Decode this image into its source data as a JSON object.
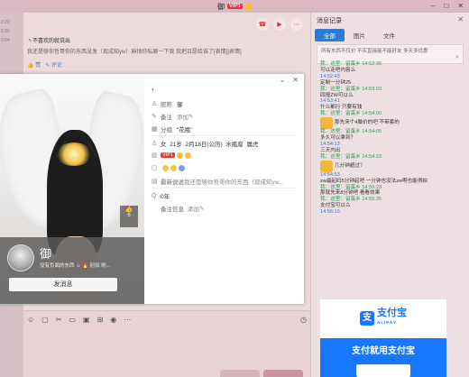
{
  "window": {
    "title": "御",
    "vip": "VIP1",
    "controls": [
      "–",
      "□",
      "✕"
    ]
  },
  "left_times": [
    "0:22",
    "5:39",
    "0:54"
  ],
  "chat": {
    "msg_header": "ヽ不喜欢的就说出",
    "msg_body": "我还是够你哲哥你的东西没发（现成知yw）麻烦你私聊一下我 我把日愿给谁了[表情][表情]",
    "like_label": "赞",
    "comment_label": "评论"
  },
  "profile": {
    "name": "御",
    "signature": "没有负面的东西 ☺ 🔥 别如 刷...",
    "send_button": "发消息",
    "likes": "6",
    "nickname_label": "昵称",
    "nickname": "御",
    "remark_label": "备注",
    "remark_action": "添加",
    "group_label": "分组",
    "group": "\"花瓶\"",
    "gender": "女",
    "age": "21岁",
    "birthday": "2月18日(公历)",
    "zodiac": "水瓶座",
    "blood": "属虎",
    "vip_tag": "VIP1",
    "status_label": "最新说说",
    "status": "我还是够你哲哥你的东西（现成知yw...",
    "q_age": "0年",
    "info_label": "备注信息",
    "info_action": "添加"
  },
  "history": {
    "title": "消息记录",
    "tabs": [
      "全部",
      "图片",
      "文件"
    ],
    "search_hint": "所有东西不仅价 不实直接能不能好友 多天多优惠",
    "entries": [
      {
        "kind": "meta",
        "text": "我：这里：留蛋乡 14:52:36"
      },
      {
        "kind": "text",
        "text": "可以走吧内容么"
      },
      {
        "kind": "time",
        "text": "14:52:43"
      },
      {
        "kind": "text",
        "text": "定制一分钟25"
      },
      {
        "kind": "meta",
        "text": "我：这里：留蛋乡 14:53:03"
      },
      {
        "kind": "text",
        "text": "四报ZW可以么"
      },
      {
        "kind": "time",
        "text": "14:53:41"
      },
      {
        "kind": "text",
        "text": "什么都行 只要有钱"
      },
      {
        "kind": "meta",
        "text": "我：这里：留蛋乡 14:54:00"
      },
      {
        "kind": "sticker",
        "text": "那先来个4脑价的吧 不带套的"
      },
      {
        "kind": "meta",
        "text": "我：这里：留蛋乡 14:54:05"
      },
      {
        "kind": "text",
        "text": "多久可以拿到？"
      },
      {
        "kind": "time",
        "text": "14:54:13"
      },
      {
        "kind": "text",
        "text": "三天内出"
      },
      {
        "kind": "meta",
        "text": "我：这里：留蛋乡 14:54:23"
      },
      {
        "kind": "sticker",
        "text": "几分钟超过？"
      },
      {
        "kind": "time",
        "text": "14:54:53"
      },
      {
        "kind": "text",
        "text": "zw最起码5分钟起吧 一分钟也没法zw啊也能得拍"
      },
      {
        "kind": "meta",
        "text": "我：这里：留蛋乡 14:55:23"
      },
      {
        "kind": "text",
        "text": "那就先来8分钟吧 看看效果"
      },
      {
        "kind": "meta",
        "text": "我：这里：留蛋乡 14:55:35"
      },
      {
        "kind": "text",
        "text": "支付宝可以么"
      },
      {
        "kind": "time",
        "text": "14:56:15"
      }
    ]
  },
  "alipay": {
    "brand": "支付宝",
    "sub": "ALIPAY",
    "slogan": "支付就用支付宝"
  },
  "colors": {
    "accent": "#2e7bd6",
    "alipay": "#1677ff",
    "meta_green": "#2f9e58"
  }
}
